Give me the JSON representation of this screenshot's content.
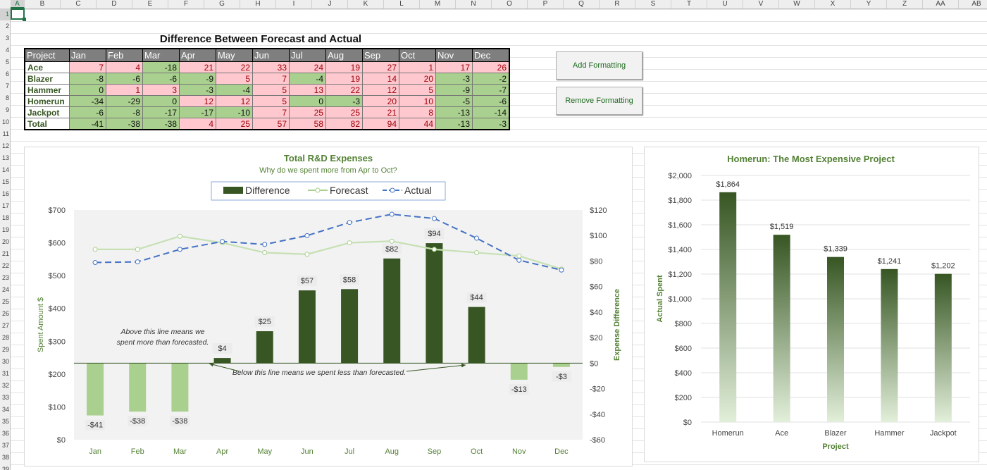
{
  "columns": [
    "A",
    "B",
    "C",
    "D",
    "E",
    "F",
    "G",
    "H",
    "I",
    "J",
    "K",
    "L",
    "M",
    "N",
    "O",
    "P",
    "Q",
    "R",
    "S",
    "T",
    "U",
    "V",
    "W",
    "X",
    "Y",
    "Z",
    "AA",
    "AB"
  ],
  "rows": [
    "1",
    "2",
    "3",
    "4",
    "5",
    "6",
    "7",
    "8",
    "9",
    "10",
    "11",
    "12",
    "13",
    "14",
    "15",
    "16",
    "17",
    "18",
    "19",
    "20",
    "21",
    "22",
    "23",
    "24",
    "25",
    "26",
    "27",
    "28",
    "29",
    "30",
    "31",
    "32",
    "33",
    "34",
    "35",
    "36",
    "37",
    "38",
    "39"
  ],
  "table": {
    "title": "Difference Between Forecast and Actual",
    "headers": [
      "Project",
      "Jan",
      "Feb",
      "Mar",
      "Apr",
      "May",
      "Jun",
      "Jul",
      "Aug",
      "Sep",
      "Oct",
      "Nov",
      "Dec"
    ],
    "rows": [
      {
        "name": "Ace",
        "values": [
          7,
          4,
          -18,
          21,
          22,
          33,
          24,
          19,
          27,
          1,
          17,
          26
        ]
      },
      {
        "name": "Blazer",
        "values": [
          -8,
          -6,
          -6,
          -9,
          5,
          7,
          -4,
          19,
          14,
          20,
          -3,
          -2
        ]
      },
      {
        "name": "Hammer",
        "values": [
          0,
          1,
          3,
          -3,
          -4,
          5,
          13,
          22,
          12,
          5,
          -9,
          -7
        ]
      },
      {
        "name": "Homerun",
        "values": [
          -34,
          -29,
          0,
          12,
          12,
          5,
          0,
          -3,
          20,
          10,
          -5,
          -6
        ]
      },
      {
        "name": "Jackpot",
        "values": [
          -6,
          -8,
          -17,
          -17,
          -10,
          7,
          25,
          25,
          21,
          8,
          -13,
          -14
        ]
      },
      {
        "name": "Total",
        "values": [
          -41,
          -38,
          -38,
          4,
          25,
          57,
          58,
          82,
          94,
          44,
          -13,
          -3
        ]
      }
    ]
  },
  "buttons": {
    "add": "Add Formatting",
    "remove": "Remove Formatting"
  },
  "colors": {
    "pos_fill": "#ffc7ce",
    "pos_text": "#9c0006",
    "neg_fill": "#a9d08e",
    "dark_green": "#375623",
    "forecast": "#a9d08e",
    "actual": "#4472c4",
    "accent": "#217346"
  },
  "chart_data": [
    {
      "type": "bar",
      "title": "Total R&D Expenses",
      "subtitle": "Why do we spent more from Apr to Oct?",
      "categories": [
        "Jan",
        "Feb",
        "Mar",
        "Apr",
        "May",
        "Jun",
        "Jul",
        "Aug",
        "Sep",
        "Oct",
        "Nov",
        "Dec"
      ],
      "series": [
        {
          "name": "Difference",
          "type": "bar",
          "axis": "right",
          "values": [
            -41,
            -38,
            -38,
            4,
            25,
            57,
            58,
            82,
            94,
            44,
            -13,
            -3
          ],
          "labels": [
            "-$41",
            "-$38",
            "-$38",
            "$4",
            "$25",
            "$57",
            "$58",
            "$82",
            "$94",
            "$44",
            "-$13",
            "-$3"
          ]
        },
        {
          "name": "Forecast",
          "type": "line",
          "axis": "left",
          "values": [
            580,
            580,
            620,
            600,
            570,
            565,
            600,
            605,
            580,
            570,
            560,
            520
          ]
        },
        {
          "name": "Actual",
          "type": "line",
          "axis": "left",
          "values": [
            540,
            542,
            580,
            604,
            595,
            622,
            662,
            687,
            674,
            614,
            547,
            517
          ]
        }
      ],
      "ylabel": "Spent Amount $",
      "ylabel_right": "Expense Difference",
      "ylim": [
        0,
        700
      ],
      "y_ticks": [
        "$0",
        "$100",
        "$200",
        "$300",
        "$400",
        "$500",
        "$600",
        "$700"
      ],
      "ylim_right": [
        -60,
        120
      ],
      "y_ticks_right": [
        "-$60",
        "-$40",
        "-$20",
        "$0",
        "$20",
        "$40",
        "$60",
        "$80",
        "$100",
        "$120"
      ],
      "annotations": [
        "Above this line means we spent more than forecasted.",
        "Below this line means we spent less than forecasted."
      ],
      "legend": "top",
      "grid": false
    },
    {
      "type": "bar",
      "title": "Homerun: The Most Expensive Project",
      "categories": [
        "Homerun",
        "Ace",
        "Blazer",
        "Hammer",
        "Jackpot"
      ],
      "values": [
        1864,
        1519,
        1339,
        1241,
        1202
      ],
      "labels": [
        "$1,864",
        "$1,519",
        "$1,339",
        "$1,241",
        "$1,202"
      ],
      "xlabel": "Project",
      "ylabel": "Actual Spent",
      "ylim": [
        0,
        2000
      ],
      "y_ticks": [
        "$0",
        "$200",
        "$400",
        "$600",
        "$800",
        "$1,000",
        "$1,200",
        "$1,400",
        "$1,600",
        "$1,800",
        "$2,000"
      ],
      "grid": true
    }
  ]
}
